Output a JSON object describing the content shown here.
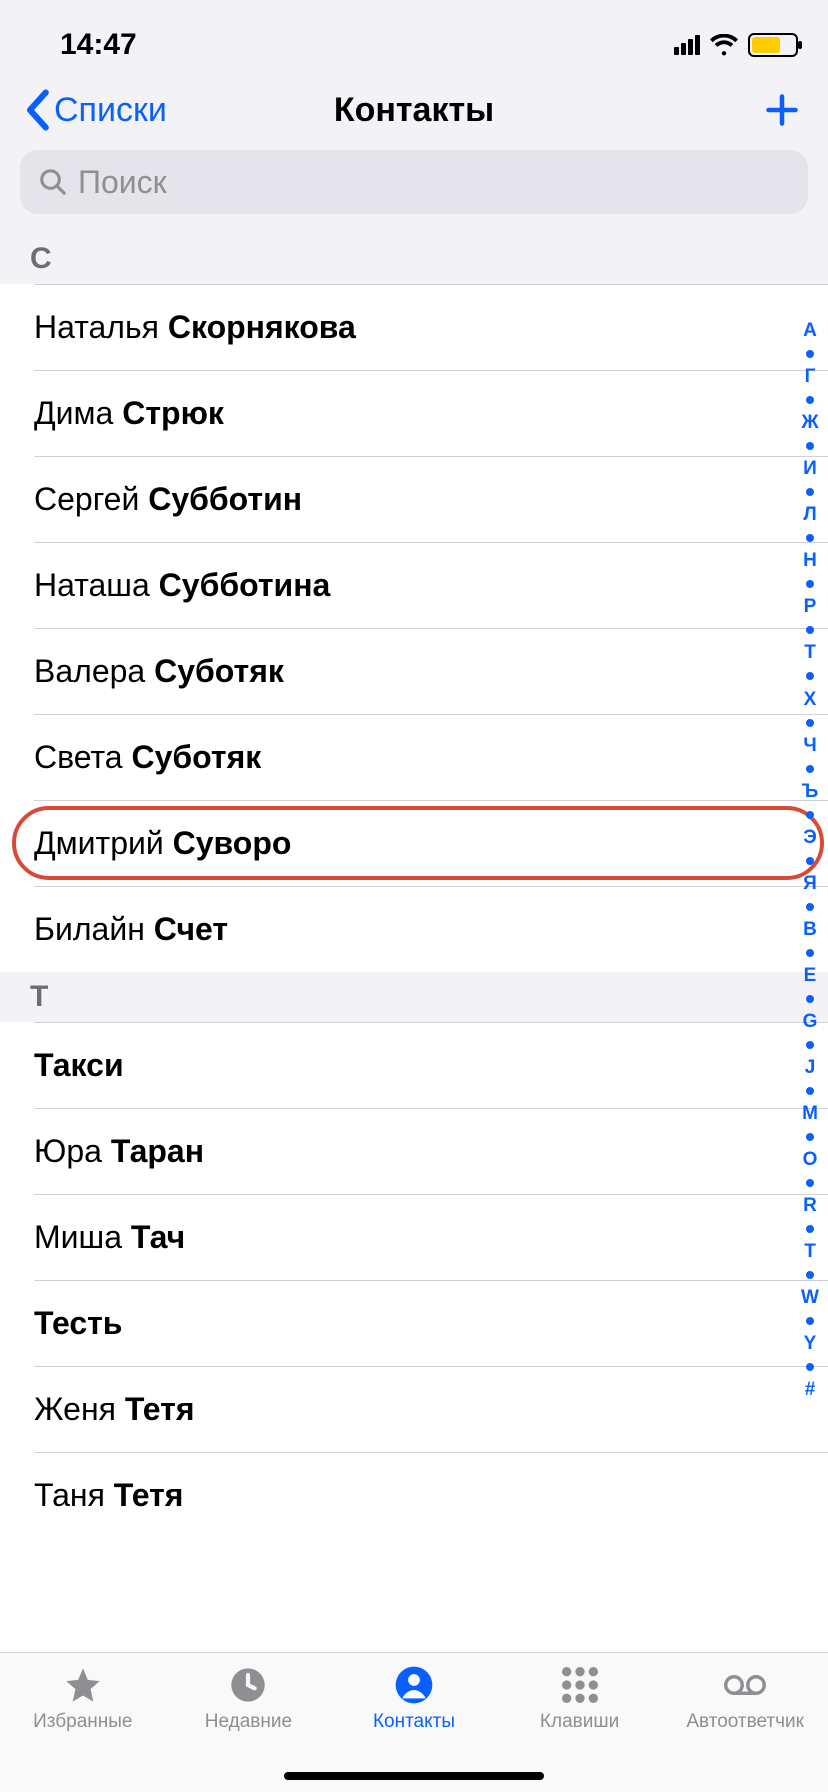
{
  "status": {
    "time": "14:47"
  },
  "nav": {
    "back_label": "Списки",
    "title": "Контакты"
  },
  "search": {
    "placeholder": "Поиск"
  },
  "sections": [
    {
      "letter": "С",
      "rows": [
        {
          "first": "Наталья",
          "last": "Скорнякова",
          "highlight": false
        },
        {
          "first": "Дима",
          "last": "Стрюк",
          "highlight": false
        },
        {
          "first": "Сергей",
          "last": "Субботин",
          "highlight": false
        },
        {
          "first": "Наташа",
          "last": "Субботина",
          "highlight": false
        },
        {
          "first": "Валера",
          "last": "Суботяк",
          "highlight": false
        },
        {
          "first": "Света",
          "last": "Суботяк",
          "highlight": false
        },
        {
          "first": "Дмитрий",
          "last": "Суворо",
          "highlight": true
        },
        {
          "first": "Билайн",
          "last": "Счет",
          "highlight": false
        }
      ]
    },
    {
      "letter": "Т",
      "rows": [
        {
          "first": "",
          "last": "Такси",
          "highlight": false
        },
        {
          "first": "Юра",
          "last": "Таран",
          "highlight": false
        },
        {
          "first": "Миша",
          "last": "Тач",
          "highlight": false
        },
        {
          "first": "",
          "last": "Тесть",
          "highlight": false
        },
        {
          "first": "Женя",
          "last": "Тетя",
          "highlight": false
        },
        {
          "first": "Таня",
          "last": "Тетя",
          "highlight": false
        }
      ]
    }
  ],
  "index_rail": [
    "А",
    "•",
    "Г",
    "•",
    "Ж",
    "•",
    "И",
    "•",
    "Л",
    "•",
    "Н",
    "•",
    "Р",
    "•",
    "Т",
    "•",
    "Х",
    "•",
    "Ч",
    "•",
    "Ъ",
    "•",
    "Э",
    "•",
    "Я",
    "•",
    "B",
    "•",
    "E",
    "•",
    "G",
    "•",
    "J",
    "•",
    "M",
    "•",
    "O",
    "•",
    "R",
    "•",
    "T",
    "•",
    "W",
    "•",
    "Y",
    "•",
    "#"
  ],
  "tabs": [
    {
      "id": "favorites",
      "label": "Избранные",
      "active": false
    },
    {
      "id": "recents",
      "label": "Недавние",
      "active": false
    },
    {
      "id": "contacts",
      "label": "Контакты",
      "active": true
    },
    {
      "id": "keypad",
      "label": "Клавиши",
      "active": false
    },
    {
      "id": "voicemail",
      "label": "Автоответчик",
      "active": false
    }
  ]
}
